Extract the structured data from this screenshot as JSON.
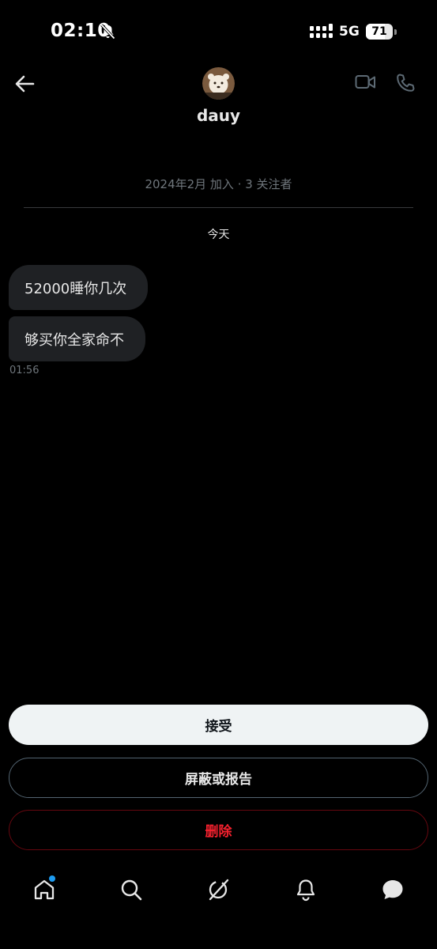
{
  "status_bar": {
    "time": "02:10",
    "network": "5G",
    "battery": 71,
    "icons": [
      "bell-slash-icon",
      "signal-icon"
    ]
  },
  "header": {
    "contact_name": "dauy",
    "icons": [
      "back-arrow-icon",
      "video-call-icon",
      "phone-call-icon"
    ]
  },
  "profile": {
    "meta": "2024年2月 加入 · 3 关注者"
  },
  "conversation": {
    "day_label": "今天",
    "messages": [
      {
        "text": "52000睡你几次"
      },
      {
        "text": "够买你全家命不"
      }
    ],
    "last_time": "01:56"
  },
  "actions": {
    "accept": "接受",
    "block_report": "屏蔽或报告",
    "delete": "删除"
  },
  "colors": {
    "background": "#000000",
    "bubble": "#1f2124",
    "accept_bg": "#eff3f4",
    "delete_text": "#f4212e",
    "notification_dot": "#1d9bf0"
  },
  "bottom_nav": {
    "items": [
      "home-icon",
      "search-icon",
      "grok-icon",
      "notifications-icon",
      "messages-icon"
    ],
    "home_has_badge": true
  }
}
